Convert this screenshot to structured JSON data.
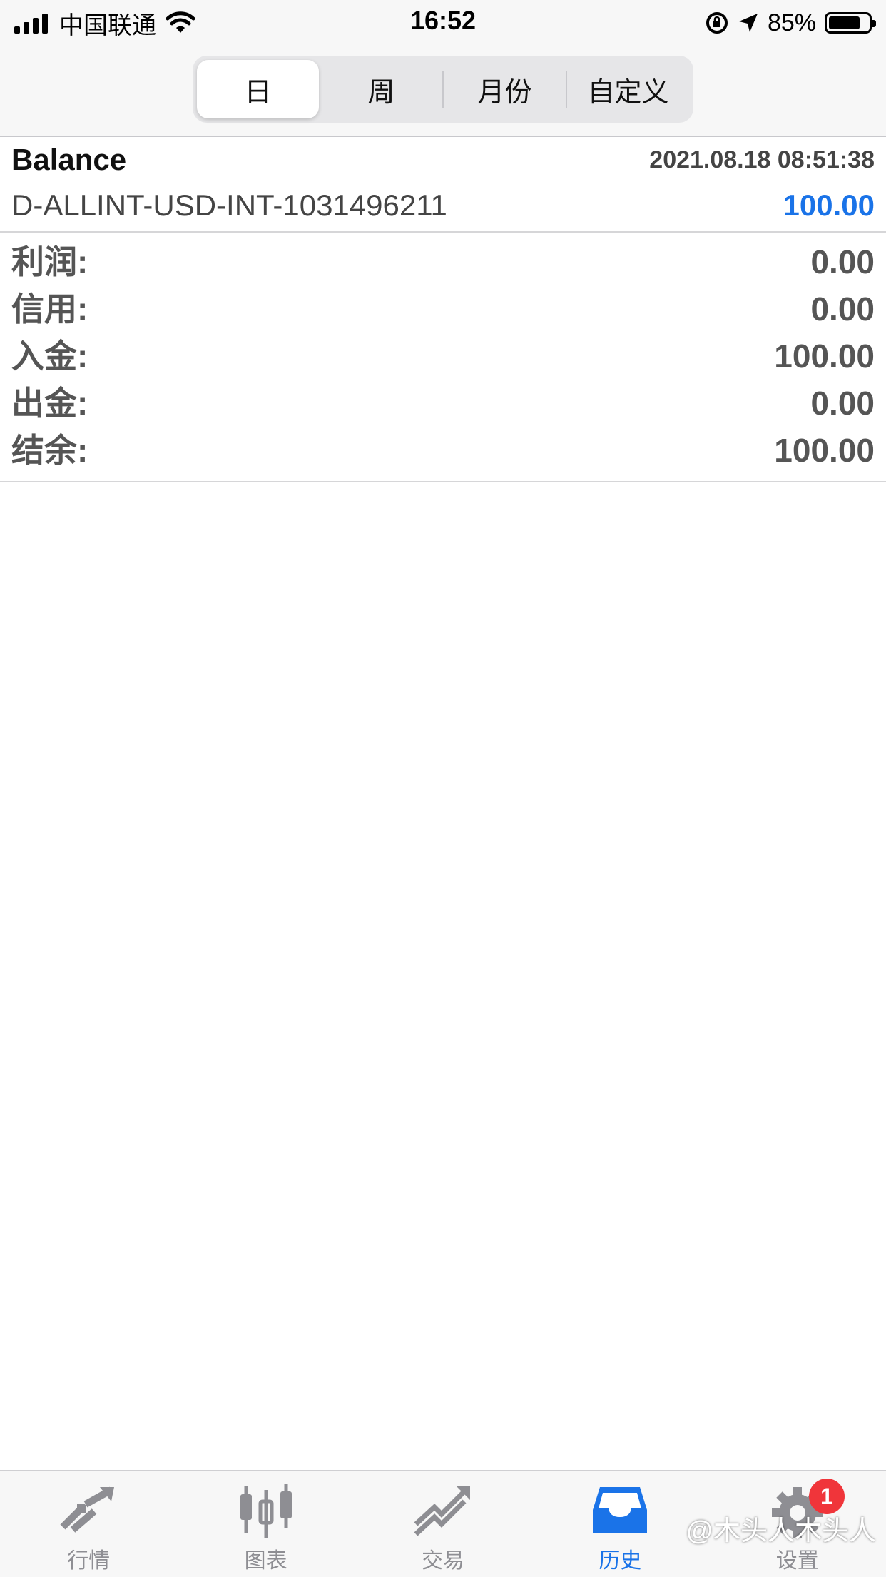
{
  "status_bar": {
    "carrier": "中国联通",
    "time": "16:52",
    "battery": "85%"
  },
  "segments": [
    {
      "label": "日",
      "active": true
    },
    {
      "label": "周",
      "active": false
    },
    {
      "label": "月份",
      "active": false
    },
    {
      "label": "自定义",
      "active": false
    }
  ],
  "record": {
    "type": "Balance",
    "datetime": "2021.08.18 08:51:38",
    "account": "D-ALLINT-USD-INT-1031496211",
    "amount": "100.00",
    "amount_color": "#1a73e8"
  },
  "summary": [
    {
      "label": "利润:",
      "value": "0.00"
    },
    {
      "label": "信用:",
      "value": "0.00"
    },
    {
      "label": "入金:",
      "value": "100.00"
    },
    {
      "label": "出金:",
      "value": "0.00"
    },
    {
      "label": "结余:",
      "value": "100.00"
    }
  ],
  "tabbar": {
    "items": [
      {
        "label": "行情",
        "icon": "quotes-arrows-icon",
        "active": false
      },
      {
        "label": "图表",
        "icon": "candlestick-chart-icon",
        "active": false
      },
      {
        "label": "交易",
        "icon": "trade-trend-icon",
        "active": false
      },
      {
        "label": "历史",
        "icon": "history-inbox-icon",
        "active": true
      },
      {
        "label": "设置",
        "icon": "gear-icon",
        "active": false
      }
    ],
    "settings_badge": "1",
    "active_color": "#1a73e8",
    "inactive_color": "#8e8e93"
  },
  "watermark": "@木头人木头人"
}
